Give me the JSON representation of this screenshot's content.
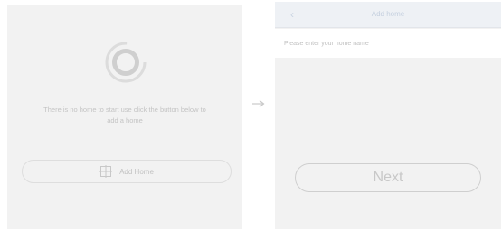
{
  "left_screen": {
    "empty_message": "There is no home to start use click the button below to add a home",
    "add_button_label": "Add Home",
    "logo_icon": "ring-logo-icon",
    "add_icon": "add-home-icon"
  },
  "flow_arrow_icon": "arrow-right-icon",
  "right_screen": {
    "nav": {
      "back_icon": "chevron-left-icon",
      "back_glyph": "‹",
      "title": "Add home"
    },
    "name_field": {
      "placeholder": "Please enter your home name",
      "value": ""
    },
    "next_button_label": "Next"
  },
  "colors": {
    "panel_background": "#f2f2f2",
    "nav_background": "#eef1f5",
    "muted_text": "#c4c4c4",
    "nav_title": "#c5d0df"
  }
}
